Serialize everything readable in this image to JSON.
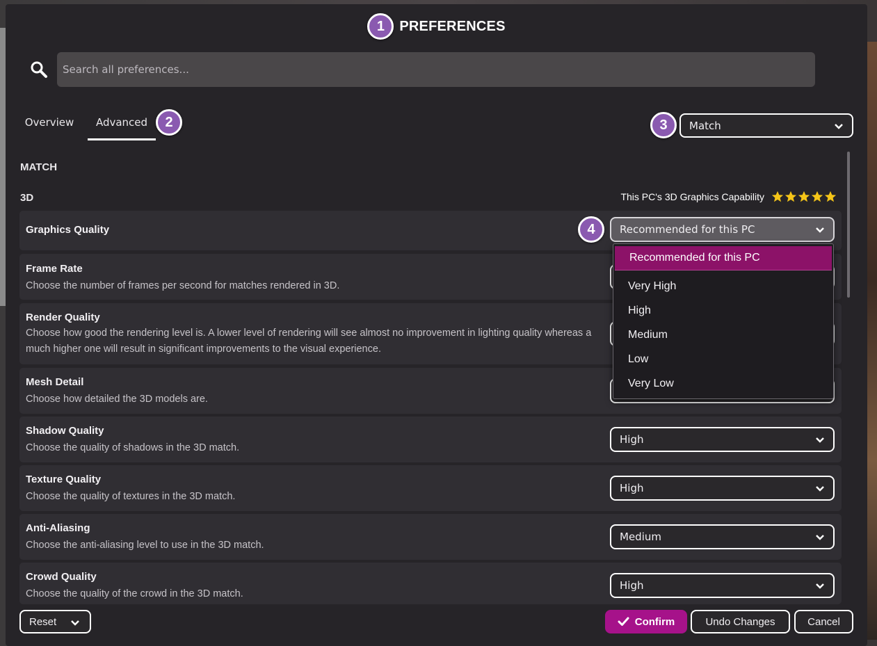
{
  "dialog": {
    "title": "PREFERENCES",
    "badges": [
      "1",
      "2",
      "3",
      "4"
    ]
  },
  "search": {
    "placeholder": "Search all preferences...",
    "value": ""
  },
  "tabs": [
    {
      "label": "Overview",
      "active": false
    },
    {
      "label": "Advanced",
      "active": true
    }
  ],
  "scope_select": {
    "value": "Match"
  },
  "section": {
    "label": "MATCH"
  },
  "subsection": {
    "label": "3D"
  },
  "capability": {
    "label": "This PC's 3D Graphics Capability",
    "stars": 5,
    "star_color": "#f5c518"
  },
  "settings": [
    {
      "name": "Graphics Quality",
      "desc": "",
      "value": "Recommended for this PC"
    },
    {
      "name": "Frame Rate",
      "desc": "Choose the number of frames per second for matches rendered in 3D.",
      "value": ""
    },
    {
      "name": "Render Quality",
      "desc": "Choose how good the rendering level is. A lower level of rendering will see almost no improvement in lighting quality whereas a much higher one will result in significant improvements to the visual experience.",
      "value": ""
    },
    {
      "name": "Mesh Detail",
      "desc": "Choose how detailed the 3D models are.",
      "value": ""
    },
    {
      "name": "Shadow Quality",
      "desc": "Choose the quality of shadows in the 3D match.",
      "value": "High"
    },
    {
      "name": "Texture Quality",
      "desc": "Choose the quality of textures in the 3D match.",
      "value": "High"
    },
    {
      "name": "Anti-Aliasing",
      "desc": "Choose the anti-aliasing level to use in the 3D match.",
      "value": "Medium"
    },
    {
      "name": "Crowd Quality",
      "desc": "Choose the quality of the crowd in the 3D match.",
      "value": "High"
    }
  ],
  "dropdown": {
    "options": [
      "Recommended for this PC",
      "Very High",
      "High",
      "Medium",
      "Low",
      "Very Low"
    ],
    "selected_index": 0,
    "highlight_color": "#8c1268"
  },
  "footer": {
    "reset_label": "Reset",
    "confirm_label": "Confirm",
    "undo_label": "Undo Changes",
    "cancel_label": "Cancel",
    "confirm_color": "#a6128a"
  }
}
